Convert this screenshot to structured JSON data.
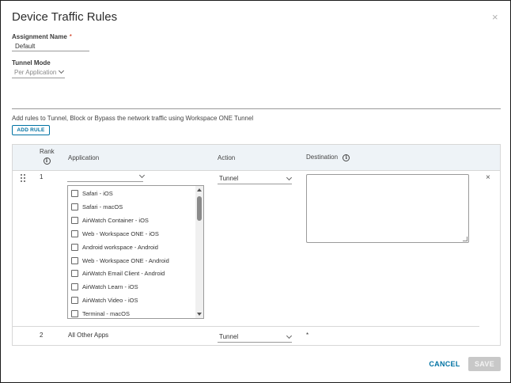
{
  "dialog": {
    "title": "Device Traffic Rules",
    "close_glyph": "×"
  },
  "assignment": {
    "label": "Assignment Name",
    "required_mark": "*",
    "value": "Default"
  },
  "tunnel_mode": {
    "label": "Tunnel Mode",
    "value": "Per Application"
  },
  "rules": {
    "description": "Add rules to Tunnel, Block or Bypass the network traffic using Workspace ONE Tunnel",
    "add_rule_label": "ADD RULE"
  },
  "grid": {
    "columns": {
      "rank": "Rank",
      "application": "Application",
      "action": "Action",
      "destination": "Destination"
    },
    "info_glyph": "i",
    "rows": [
      {
        "rank": "1",
        "application": "",
        "action": "Tunnel",
        "destination": "",
        "app_options": [
          "Safari - iOS",
          "Safari - macOS",
          "AirWatch Container - iOS",
          "Web - Workspace ONE - iOS",
          "Android workspace - Android",
          "Web - Workspace ONE - Android",
          "AirWatch Email Client - Android",
          "AirWatch Learn - iOS",
          "AirWatch Video - iOS",
          "Terminal - macOS"
        ],
        "remove_glyph": "×"
      },
      {
        "rank": "2",
        "application": "All Other Apps",
        "action": "Tunnel",
        "destination": "*"
      }
    ]
  },
  "footer": {
    "cancel_label": "CANCEL",
    "save_label": "SAVE"
  },
  "colors": {
    "accent": "#0072a3",
    "header_bg": "#eef3f7",
    "required": "#c92100",
    "disabled_button": "#c8c8c8"
  },
  "icons": {
    "close": "close-icon",
    "info": "info-icon",
    "chevron": "chevron-down-icon",
    "drag": "drag-handle-icon",
    "checkbox": "checkbox-icon"
  }
}
